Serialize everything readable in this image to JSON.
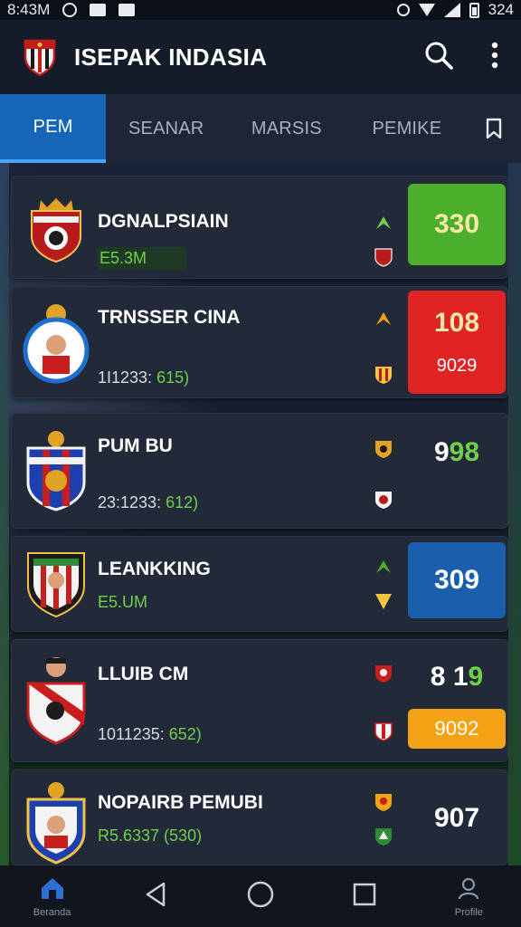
{
  "status_bar": {
    "time": "8:43M",
    "battery": "324"
  },
  "app_bar": {
    "title": "ISEPAK INDASIA",
    "search_icon": "search-icon",
    "menu_icon": "more-vert-icon"
  },
  "tabs": [
    {
      "label": "PEM",
      "active": true
    },
    {
      "label": "SEANAR",
      "active": false
    },
    {
      "label": "MARSIS",
      "active": false
    },
    {
      "label": "PEMIKE",
      "active": false
    }
  ],
  "teams": [
    {
      "name": "DGNALPSIAIN",
      "sub": "E5.3M",
      "score": "330",
      "score_color": "#4caf2c"
    },
    {
      "name": "TRNSSER CINA",
      "sub_plain": "1I1233:",
      "sub_green": "615)",
      "score": "108",
      "score_secondary": "9029",
      "score_color": "#e02424"
    },
    {
      "name": "PUM BU",
      "sub_plain": "23:1233:",
      "sub_green": "612)",
      "score_plain": "9",
      "score_green": "98"
    },
    {
      "name": "LEANKKING",
      "sub": "E5.UM",
      "score": "309",
      "score_color": "#1a5fae"
    },
    {
      "name": "LLUIB CM",
      "sub_plain": "1011235:",
      "sub_green": "652)",
      "score_plain": "8 1",
      "score_green": "9",
      "score_secondary": "9092",
      "score_secondary_color": "#f5a316"
    },
    {
      "name": "NOPAIRB PEMUBI",
      "sub": "R5.6337 (530)",
      "score": "907"
    }
  ],
  "nav_bar": {
    "home_label": "Beranda",
    "profile_label": "Profile"
  },
  "colors": {
    "accent": "#1565b8",
    "green": "#6fd04a",
    "red": "#e02424",
    "orange": "#f5a316",
    "blue": "#1a5fae"
  }
}
